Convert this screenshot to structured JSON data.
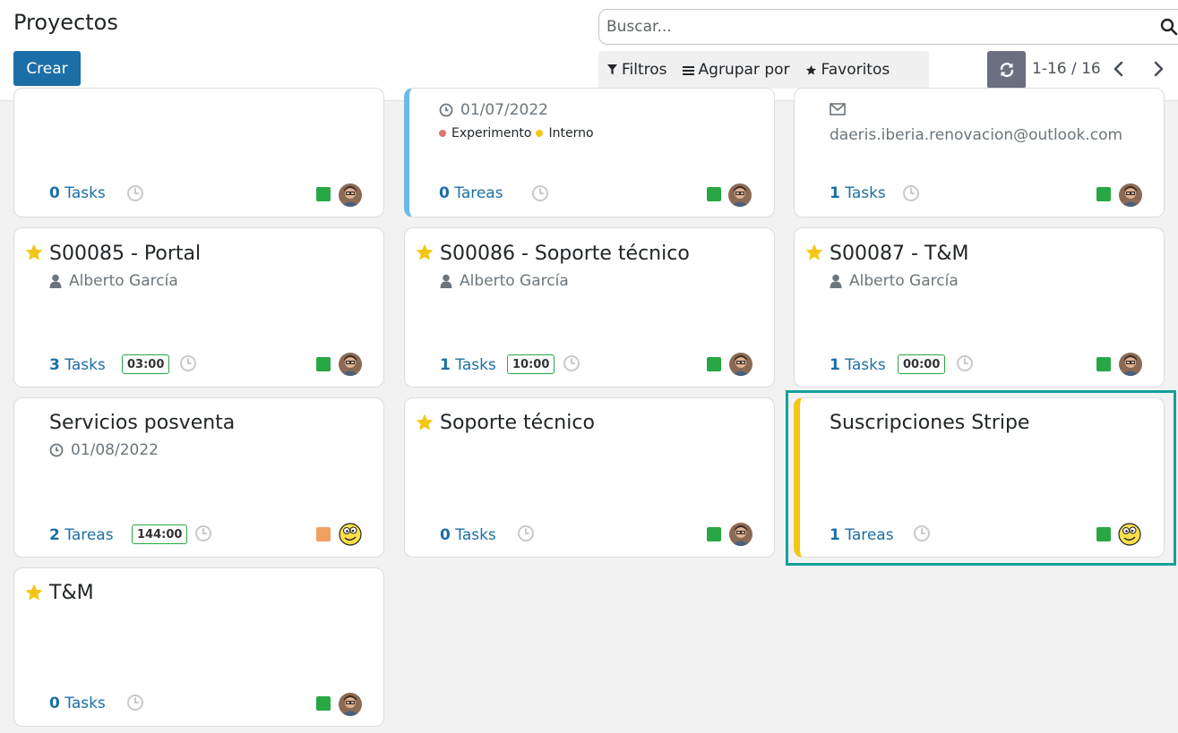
{
  "header": {
    "title": "Proyectos",
    "create_label": "Crear",
    "search_placeholder": "Buscar...",
    "filters_label": "Filtros",
    "groupby_label": "Agrupar por",
    "favorites_label": "Favoritos",
    "pager_value": "1-16 / 16"
  },
  "colors": {
    "primary": "#1b6fa6",
    "status_green": "#28a745",
    "status_orange": "#f0a060",
    "star": "#f3c614",
    "selected_border": "#12a09b",
    "card_left_blue": "#6bbbe8",
    "card_left_yellow": "#f3c614"
  },
  "cards": [
    {
      "count": "0",
      "tasks_label": " Tasks",
      "status": "green",
      "avatar": "person"
    },
    {
      "date": "01/07/2022",
      "tags": [
        "Experimento",
        "Interno"
      ],
      "tag_colors": [
        "#e57373",
        "#f3c614"
      ],
      "count": "0",
      "tasks_label": " Tareas",
      "status": "green",
      "avatar": "person"
    },
    {
      "email": "daeris.iberia.renovacion@outlook.com",
      "count": "1",
      "tasks_label": " Tasks",
      "status": "green",
      "avatar": "person"
    },
    {
      "title": "S00085 - Portal",
      "starred": true,
      "person": "Alberto García",
      "count": "3",
      "tasks_label": " Tasks",
      "time": "03:00",
      "status": "green",
      "avatar": "person"
    },
    {
      "title": "S00086 - Soporte técnico",
      "starred": true,
      "person": "Alberto García",
      "count": "1",
      "tasks_label": " Tasks",
      "time": "10:00",
      "status": "green",
      "avatar": "person"
    },
    {
      "title": "S00087 - T&M",
      "starred": true,
      "person": "Alberto García",
      "count": "1",
      "tasks_label": " Tasks",
      "time": "00:00",
      "status": "green",
      "avatar": "person"
    },
    {
      "title": "Servicios posventa",
      "starred": false,
      "date": "01/08/2022",
      "count": "2",
      "tasks_label": " Tareas",
      "time": "144:00",
      "status": "orange",
      "avatar": "emoji"
    },
    {
      "title": "Soporte técnico",
      "starred": true,
      "count": "0",
      "tasks_label": " Tasks",
      "status": "green",
      "avatar": "person"
    },
    {
      "title": "Suscripciones Stripe",
      "starred": false,
      "count": "1",
      "tasks_label": " Tareas",
      "status": "green",
      "avatar": "emoji",
      "selected": true
    },
    {
      "title": "T&M",
      "starred": true,
      "count": "0",
      "tasks_label": " Tasks",
      "status": "green",
      "avatar": "person"
    }
  ]
}
